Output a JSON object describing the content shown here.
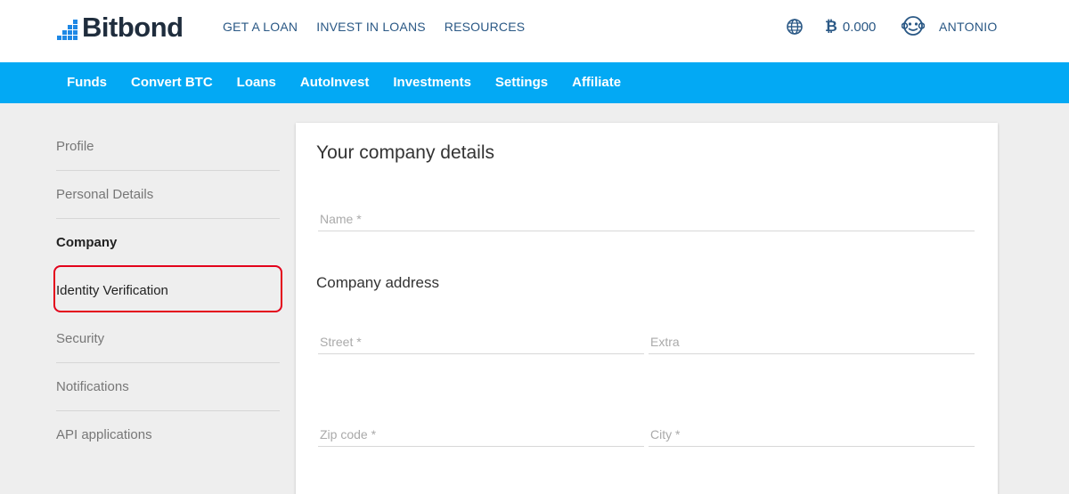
{
  "brand": {
    "name": "Bitbond",
    "color": "#1e88e5"
  },
  "topnav": {
    "items": [
      {
        "label": "GET A LOAN"
      },
      {
        "label": "INVEST IN LOANS"
      },
      {
        "label": "RESOURCES"
      }
    ]
  },
  "header_right": {
    "language_icon": "globe-icon",
    "btc_symbol": "₿",
    "btc_balance": "0.000",
    "avatar_icon": "monkey-avatar-icon",
    "username": "ANTONIO"
  },
  "mainnav": {
    "color": "#03a9f4",
    "items": [
      {
        "label": "Funds"
      },
      {
        "label": "Convert BTC"
      },
      {
        "label": "Loans"
      },
      {
        "label": "AutoInvest"
      },
      {
        "label": "Investments"
      },
      {
        "label": "Settings"
      },
      {
        "label": "Affiliate"
      }
    ]
  },
  "sidebar": {
    "items": [
      {
        "label": "Profile"
      },
      {
        "label": "Personal Details"
      },
      {
        "label": "Company"
      },
      {
        "label": "Identity Verification"
      },
      {
        "label": "Security"
      },
      {
        "label": "Notifications"
      },
      {
        "label": "API applications"
      }
    ],
    "active": "Company",
    "highlighted": "Identity Verification",
    "highlight_color": "#e3001b"
  },
  "company_form": {
    "title": "Your company details",
    "name": {
      "placeholder": "Name *",
      "value": ""
    },
    "address_title": "Company address",
    "street": {
      "placeholder": "Street *",
      "value": ""
    },
    "extra": {
      "placeholder": "Extra",
      "value": ""
    },
    "zip": {
      "placeholder": "Zip code *",
      "value": ""
    },
    "city": {
      "placeholder": "City *",
      "value": ""
    }
  }
}
